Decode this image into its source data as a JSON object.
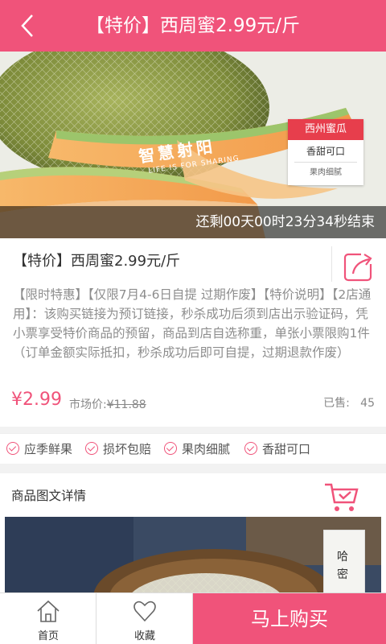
{
  "header": {
    "title": "【特价】西周蜜2.99元/斤",
    "back_icon": "chevron-left-icon"
  },
  "hero": {
    "tag": {
      "line1": "西州蜜瓜",
      "line2": "香甜可口",
      "line3": "果肉细腻"
    },
    "brand": "智慧射阳",
    "slogan": "LIFE IS FOR SHARING",
    "countdown": "还剩00天00时23分34秒结束"
  },
  "product": {
    "name": "【特价】西周蜜2.99元/斤",
    "description": "【限时特惠】【仅限7月4-6日自提 过期作废】【特价说明】【2店通用】：该购买链接为预订链接，秒杀成功后须到店出示验证码，凭小票享受特价商品的预留，商品到店自选称重，单张小票限购1件（订单金额实际抵扣，秒杀成功后即可自提，过期退款作废）",
    "price": "¥2.99",
    "market_label": "市场价:",
    "market_price": "¥11.88",
    "sold_label": "已售:",
    "sold_count": "45",
    "share_icon": "share-icon"
  },
  "features": [
    "应季鲜果",
    "损坏包赔",
    "果肉细腻",
    "香甜可口"
  ],
  "detail": {
    "title": "商品图文详情",
    "tag_text": "哈密",
    "cart_icon": "cart-icon"
  },
  "bottom": {
    "home_label": "首页",
    "fav_label": "收藏",
    "buy_label": "马上购买"
  },
  "colors": {
    "accent": "#f0537a",
    "tag_red": "#e73e4c"
  }
}
